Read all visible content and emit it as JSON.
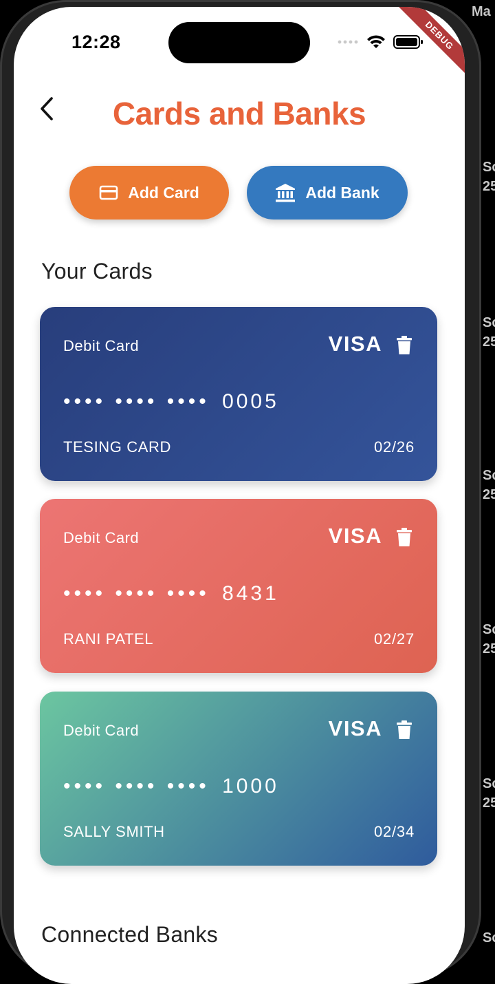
{
  "status_bar": {
    "time": "12:28",
    "debug_label": "DEBUG"
  },
  "background_peek": {
    "top_right": "Ma",
    "items": [
      "Sc",
      "25"
    ]
  },
  "header": {
    "title": "Cards and Banks",
    "back_icon": "chevron-left-icon"
  },
  "actions": {
    "add_card": {
      "label": "Add Card",
      "icon": "credit-card-icon",
      "color": "#ec7a33"
    },
    "add_bank": {
      "label": "Add Bank",
      "icon": "bank-icon",
      "color": "#3479bf"
    }
  },
  "cards_section": {
    "title": "Your Cards"
  },
  "cards": [
    {
      "type": "Debit Card",
      "brand": "VISA",
      "masked": "•••• •••• ••••",
      "last4": "0005",
      "holder": "TESING CARD",
      "expiry": "02/26",
      "gradient": [
        "#283e7c",
        "#34549a"
      ]
    },
    {
      "type": "Debit Card",
      "brand": "VISA",
      "masked": "•••• •••• ••••",
      "last4": "8431",
      "holder": "RANI PATEL",
      "expiry": "02/27",
      "gradient": [
        "#ec7573",
        "#de6352"
      ]
    },
    {
      "type": "Debit Card",
      "brand": "VISA",
      "masked": "•••• •••• ••••",
      "last4": "1000",
      "holder": "SALLY SMITH",
      "expiry": "02/34",
      "gradient": [
        "#6cc6a0",
        "#2f5b9d"
      ]
    }
  ],
  "banks_section": {
    "title": "Connected Banks"
  },
  "colors": {
    "accent": "#e8633a",
    "background": "#ffffff"
  }
}
